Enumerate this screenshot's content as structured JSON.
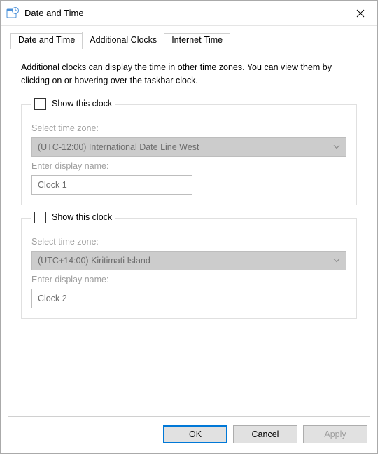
{
  "window": {
    "title": "Date and Time"
  },
  "tabs": {
    "dateTime": "Date and Time",
    "additionalClocks": "Additional Clocks",
    "internetTime": "Internet Time"
  },
  "description": "Additional clocks can display the time in other time zones. You can view them by clicking on or hovering over the taskbar clock.",
  "labels": {
    "showThisClock": "Show this clock",
    "selectTimeZone": "Select time zone:",
    "enterDisplayName": "Enter display name:"
  },
  "clock1": {
    "checked": false,
    "timezone": "(UTC-12:00) International Date Line West",
    "displayName": "Clock 1"
  },
  "clock2": {
    "checked": false,
    "timezone": "(UTC+14:00) Kiritimati Island",
    "displayName": "Clock 2"
  },
  "buttons": {
    "ok": "OK",
    "cancel": "Cancel",
    "apply": "Apply"
  }
}
